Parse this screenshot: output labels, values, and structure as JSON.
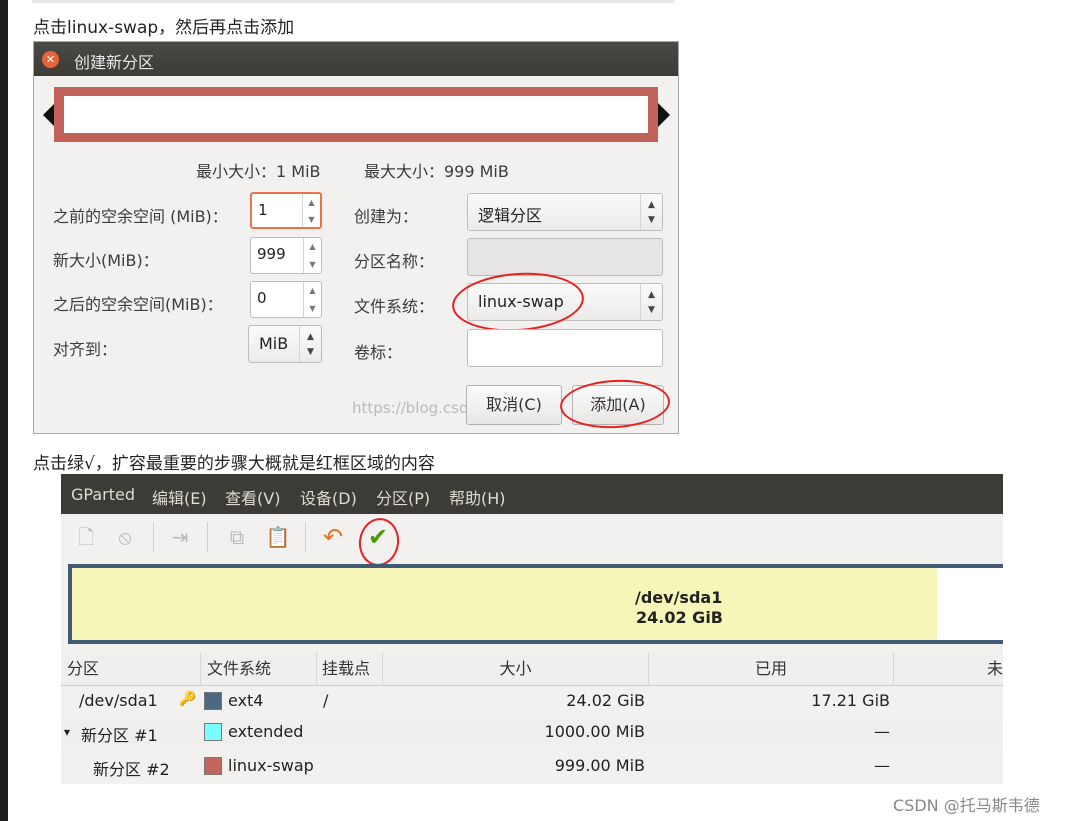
{
  "captions": {
    "first": "点击linux-swap，然后再点击添加",
    "second": "点击绿√，扩容最重要的步骤大概就是红框区域的内容"
  },
  "dialog": {
    "title": "创建新分区",
    "min_size": "最小大小：1 MiB",
    "max_size": "最大大小：999 MiB",
    "labels": {
      "free_before": "之前的空余空间 (MiB)：",
      "new_size": "新大小(MiB)：",
      "free_after": "之后的空余空间(MiB)：",
      "align_to": "对齐到：",
      "create_as": "创建为：",
      "partition_name": "分区名称：",
      "file_system": "文件系统：",
      "label": "卷标："
    },
    "values": {
      "free_before": "1",
      "new_size": "999",
      "free_after": "0",
      "align_to": "MiB",
      "create_as": "逻辑分区",
      "partition_name": "",
      "file_system": "linux-swap",
      "label": ""
    },
    "buttons": {
      "cancel": "取消(C)",
      "add": "添加(A)"
    },
    "watermark": "https://blog.csdn.net/..."
  },
  "gparted": {
    "menu": [
      "GParted",
      "编辑(E)",
      "查看(V)",
      "设备(D)",
      "分区(P)",
      "帮助(H)"
    ],
    "disk_map": {
      "name": "/dev/sda1",
      "size": "24.02 GiB"
    },
    "columns": [
      "分区",
      "文件系统",
      "挂载点",
      "大小",
      "已用",
      "未"
    ],
    "rows": [
      {
        "partition": "/dev/sda1",
        "fs": "ext4",
        "mount": "/",
        "size": "24.02 GiB",
        "used": "17.21 GiB",
        "color": "#4b6984",
        "expander": "",
        "has_key": true
      },
      {
        "partition": "新分区 #1",
        "fs": "extended",
        "mount": "",
        "size": "1000.00 MiB",
        "used": "—",
        "color": "#7dfcfe",
        "expander": "▾",
        "has_key": false
      },
      {
        "partition": "新分区 #2",
        "fs": "linux-swap",
        "mount": "",
        "size": "999.00 MiB",
        "used": "—",
        "color": "#c1665a",
        "expander": "",
        "has_key": false
      }
    ]
  },
  "footer": {
    "csdn": "CSDN @托马斯韦德"
  },
  "colors": {
    "accent": "#e52222",
    "titlebar": "#3c3b37",
    "sda1": "#f6f6b8",
    "swap": "#c1665a",
    "extended": "#7dfcfe",
    "ext4": "#4b6984"
  }
}
